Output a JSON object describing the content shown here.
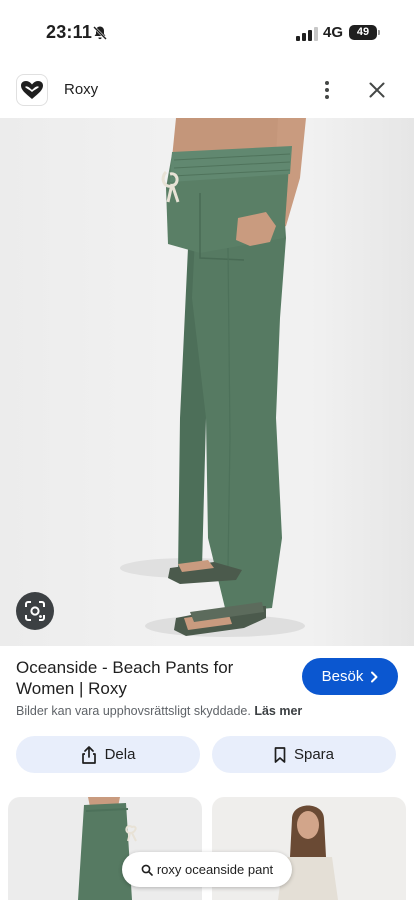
{
  "status_bar": {
    "time": "23:11",
    "network": "4G",
    "battery": "49"
  },
  "header": {
    "site_name": "Roxy"
  },
  "result": {
    "title": "Oceanside - Beach Pants for Women | Roxy",
    "visit_label": "Besök",
    "copyright_notice": "Bilder kan vara upphovsrättsligt skyddade.",
    "learn_more": "Läs mer"
  },
  "actions": {
    "share_label": "Dela",
    "save_label": "Spara"
  },
  "search": {
    "query": "roxy oceanside pant"
  },
  "colors": {
    "accent": "#0b57d0",
    "action_bg": "#e8eefb",
    "pants": "#557a61"
  }
}
